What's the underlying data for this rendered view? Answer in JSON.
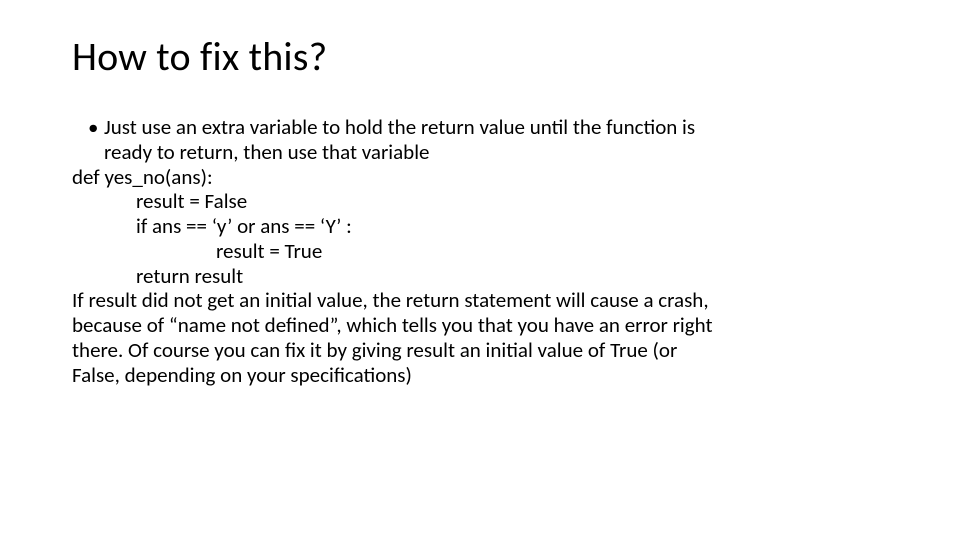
{
  "title": "How to fix this?",
  "bullet": {
    "line1": "Just use an extra variable to hold the return value until the function is",
    "line2": "ready to return, then use that variable"
  },
  "code": {
    "def": "def yes_no(ans):",
    "l1": "result = False",
    "l2": "if ans == ‘y’ or ans == ‘Y’ :",
    "l3": "result = True",
    "l4": "return result"
  },
  "para": {
    "p1": "If result did not get an initial value, the return statement will cause a crash,",
    "p2": "because of “name not defined”, which tells you that you have an error right",
    "p3": "there.  Of course you can fix it by giving result an initial value of True (or",
    "p4": "False, depending on your specifications)"
  }
}
